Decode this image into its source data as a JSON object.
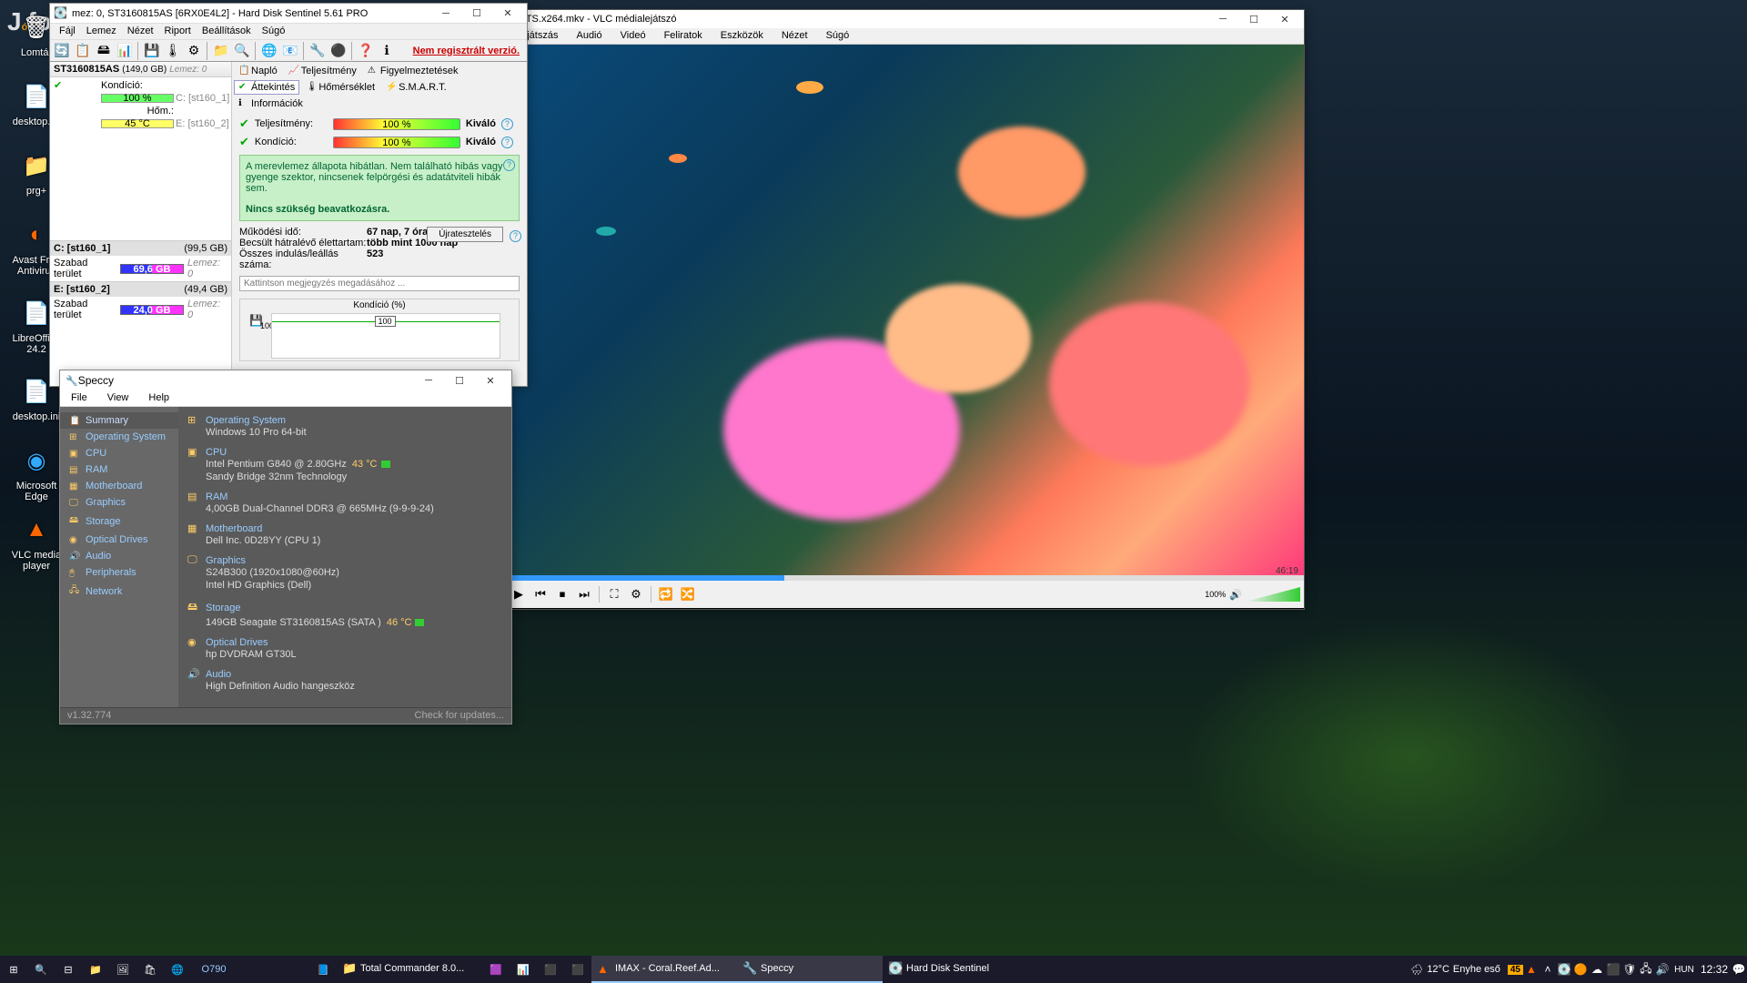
{
  "watermark": "Jófogás",
  "desktop_icons": [
    {
      "label": "Lomtár",
      "glyph": "🗑"
    },
    {
      "label": "desktop.ini",
      "glyph": "📄"
    },
    {
      "label": "prg+",
      "glyph": "📁"
    },
    {
      "label": "Avast Free Antivirus",
      "glyph": "🟠"
    },
    {
      "label": "LibreOffice 24.2",
      "glyph": "📄"
    },
    {
      "label": "desktop.ini",
      "glyph": "📄"
    },
    {
      "label": "Microsoft Edge",
      "glyph": "🌐"
    },
    {
      "label": "VLC media player",
      "glyph": "▲"
    }
  ],
  "hds": {
    "title": "mez: 0, ST3160815AS [6RX0E4L2]  -  Hard Disk Sentinel 5.61 PRO",
    "menu": [
      "Fájl",
      "Lemez",
      "Nézet",
      "Riport",
      "Beállítások",
      "Súgó"
    ],
    "reg_link": "Nem regisztrált verzió.",
    "disk": {
      "model": "ST3160815AS",
      "size": "(149,0 GB)",
      "lemez": "Lemez: 0"
    },
    "cond": {
      "label": "Kondíció:",
      "value": "100 %",
      "drive": "C: [st160_1]"
    },
    "temp": {
      "label": "Hőm.:",
      "value": "45 °C",
      "drive": "E: [st160_2]"
    },
    "partitions": [
      {
        "name": "C: [st160_1]",
        "size": "(99,5 GB)",
        "free_label": "Szabad terület",
        "free": "69,6 GB",
        "lemez": "Lemez: 0"
      },
      {
        "name": "E: [st160_2]",
        "size": "(49,4 GB)",
        "free_label": "Szabad terület",
        "free": "24,0 GB",
        "lemez": "Lemez: 0"
      }
    ],
    "tabs": [
      {
        "label": "Napló"
      },
      {
        "label": "Teljesítmény"
      },
      {
        "label": "Figyelmeztetések"
      },
      {
        "label": "Áttekintés",
        "active": true
      },
      {
        "label": "Hőmérséklet"
      },
      {
        "label": "S.M.A.R.T."
      },
      {
        "label": "Információk"
      }
    ],
    "perf": {
      "label": "Teljesítmény:",
      "value": "100 %",
      "rating": "Kiváló"
    },
    "health": {
      "label": "Kondíció:",
      "value": "100 %",
      "rating": "Kiváló"
    },
    "health_msg": "A merevlemez állapota hibátlan. Nem található hibás vagy gyenge szektor, nincsenek felpörgési és adatátviteli hibák sem.",
    "health_action": "Nincs szükség beavatkozásra.",
    "stats": [
      {
        "label": "Működési idő:",
        "value": "67 nap, 7 óra"
      },
      {
        "label": "Becsült hátralévő élettartam:",
        "value": "több mint 1000 nap"
      },
      {
        "label": "Összes indulás/leállás száma:",
        "value": "523"
      }
    ],
    "retest": "Újratesztelés",
    "comment_placeholder": "Kattintson megjegyzés megadásához ...",
    "chart_title": "Kondíció  (%)",
    "chart_value": "100"
  },
  "speccy": {
    "title": "Speccy",
    "menu": [
      "File",
      "View",
      "Help"
    ],
    "nav": [
      "Summary",
      "Operating System",
      "CPU",
      "RAM",
      "Motherboard",
      "Graphics",
      "Storage",
      "Optical Drives",
      "Audio",
      "Peripherals",
      "Network"
    ],
    "sections": {
      "os": {
        "h": "Operating System",
        "d": "Windows 10 Pro 64-bit"
      },
      "cpu": {
        "h": "CPU",
        "d1": "Intel Pentium G840 @ 2.80GHz",
        "temp": "43 °C",
        "d2": "Sandy Bridge 32nm Technology"
      },
      "ram": {
        "h": "RAM",
        "d": "4,00GB Dual-Channel DDR3 @ 665MHz (9-9-9-24)"
      },
      "mb": {
        "h": "Motherboard",
        "d": "Dell Inc. 0D28YY (CPU 1)"
      },
      "gfx": {
        "h": "Graphics",
        "d1": "S24B300 (1920x1080@60Hz)",
        "d2": "Intel HD Graphics (Dell)"
      },
      "sto": {
        "h": "Storage",
        "d": "149GB Seagate ST3160815AS (SATA )",
        "temp": "46 °C"
      },
      "opt": {
        "h": "Optical Drives",
        "d": "hp DVDRAM GT30L"
      },
      "aud": {
        "h": "Audio",
        "d": "High Definition Audio hangeszköz"
      }
    },
    "version": "v1.32.774",
    "updates": "Check for updates..."
  },
  "vlc": {
    "title": "DTS.x264.mkv - VLC médialejátszó",
    "menu": [
      "Lejátszás",
      "Audió",
      "Videó",
      "Feliratok",
      "Eszközök",
      "Nézet",
      "Súgó"
    ],
    "time": "46:19",
    "volume": "100%"
  },
  "taskbar": {
    "search": "O790",
    "tasks": [
      {
        "icon": "📁",
        "label": "Total Commander 8.0..."
      },
      {
        "icon": "▲",
        "label": "IMAX - Coral.Reef.Ad...",
        "active": true
      },
      {
        "icon": "🔧",
        "label": "Speccy",
        "active": true
      },
      {
        "icon": "💽",
        "label": "Hard Disk Sentinel"
      }
    ],
    "weather": {
      "temp": "12°C",
      "desc": "Enyhe eső"
    },
    "hd_temp": "45",
    "lang": "HUN",
    "clock": "12:32"
  }
}
